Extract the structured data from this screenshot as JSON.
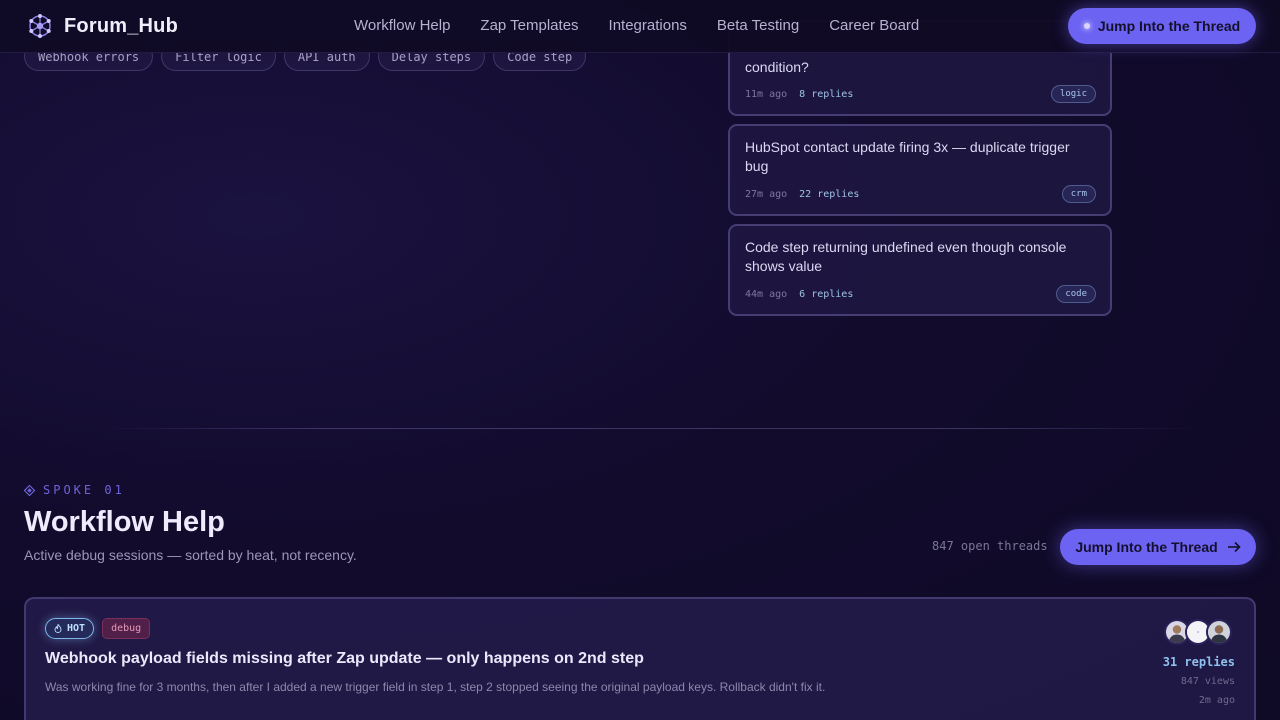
{
  "nav": {
    "brand": "Forum_Hub",
    "logo_icon": "network-hub-icon",
    "links": [
      "Workflow Help",
      "Zap Templates",
      "Integrations",
      "Beta Testing",
      "Career Board"
    ],
    "cta": "Jump Into the Thread"
  },
  "chips": [
    "Webhook errors",
    "Filter logic",
    "API auth",
    "Delay steps",
    "Code step"
  ],
  "threads": [
    {
      "title": "condition?",
      "time": "11m ago",
      "replies": "8 replies",
      "tag": "logic"
    },
    {
      "title": "HubSpot contact update firing 3x — duplicate trigger bug",
      "time": "27m ago",
      "replies": "22 replies",
      "tag": "crm"
    },
    {
      "title": "Code step returning undefined even though console shows value",
      "time": "44m ago",
      "replies": "6 replies",
      "tag": "code"
    }
  ],
  "section": {
    "spoke": "SPOKE 01",
    "spoke_icon": "diamond-icon",
    "title": "Workflow Help",
    "subtitle": "Active debug sessions — sorted by heat, not recency.",
    "open_threads": "847 open threads",
    "cta": "Jump Into the Thread",
    "cta_icon": "arrow-right-icon"
  },
  "hot_thread": {
    "hot_label": "HOT",
    "hot_icon": "flame-icon",
    "tag": "debug",
    "title": "Webhook payload fields missing after Zap update — only happens on 2nd step",
    "excerpt": "Was working fine for 3 months, then after I added a new trigger field in step 1, step 2 stopped seeing the original payload keys. Rollback didn't fix it.",
    "replies": "31 replies",
    "views": "847 views",
    "time": "2m ago"
  },
  "colors": {
    "accent": "#6c63f2",
    "background": "#120b2c",
    "reply_blue": "#8ec1ee"
  }
}
